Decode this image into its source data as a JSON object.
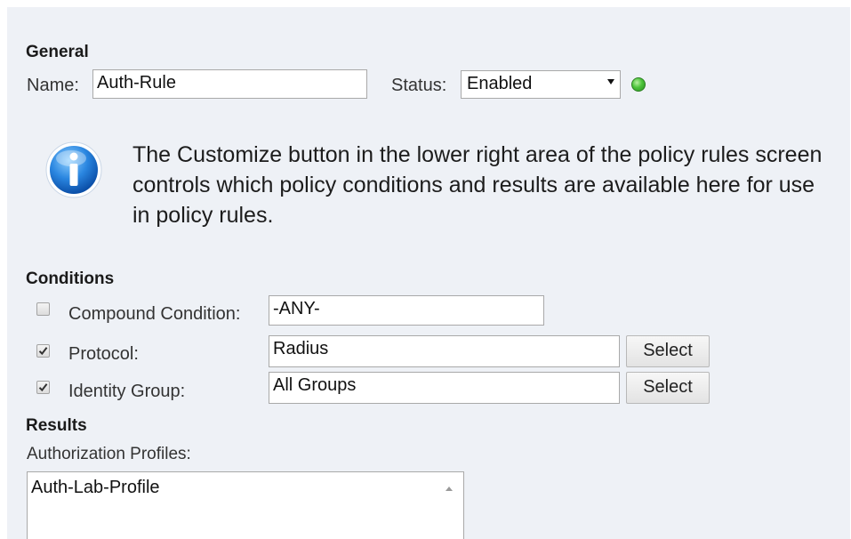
{
  "general": {
    "title": "General",
    "name_label": "Name:",
    "name_value": "Auth-Rule",
    "status_label": "Status:",
    "status_value": "Enabled",
    "status_color": "#4cc33a"
  },
  "info": {
    "icon": "info-icon",
    "text": "The Customize button in the lower right area of the policy rules screen controls which policy conditions and results are available here for use in policy rules."
  },
  "conditions": {
    "title": "Conditions",
    "compound": {
      "label": "Compound Condition:",
      "checked": false,
      "value": "-ANY-"
    },
    "protocol": {
      "label": "Protocol:",
      "checked": true,
      "value": "Radius",
      "button": "Select"
    },
    "identity_group": {
      "label": "Identity Group:",
      "checked": true,
      "value": "All Groups",
      "button": "Select"
    }
  },
  "results": {
    "title": "Results",
    "profiles_label": "Authorization Profiles:",
    "profiles": [
      "Auth-Lab-Profile"
    ]
  }
}
